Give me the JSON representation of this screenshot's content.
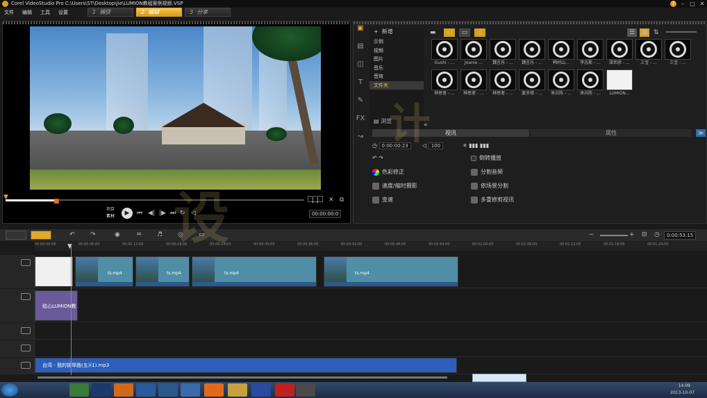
{
  "window": {
    "title": "Corel VideoStudio Pro    C:\\Users\\ST\\Desktop\\jie\\LUMION教程案例视频.VSP"
  },
  "menu": {
    "items": [
      "文件",
      "编辑",
      "工具",
      "设置"
    ]
  },
  "steps": [
    {
      "num": "1",
      "label": "捕获"
    },
    {
      "num": "2",
      "label": "编辑"
    },
    {
      "num": "3",
      "label": "分享"
    }
  ],
  "player": {
    "mode_top": "项目",
    "mode_bottom": "素材",
    "timecode": "00:00:00:0",
    "scrub_progress": 0.17
  },
  "library": {
    "add_label": "新增",
    "folders": [
      "示例",
      "视频",
      "图片",
      "音乐",
      "音效",
      "文件夹"
    ],
    "selected_folder": "文件夹",
    "browse_label": "浏览",
    "thumbs": [
      "Gushi - ...",
      "Joanie ...",
      "魏言乐 - ...",
      "魏言乐 - ...",
      "韩村山...",
      "李志斯 - ...",
      "梁邦彦 - ...",
      "三宝 - ...",
      "三宝 - ...",
      "神思者 - ...",
      "神思者 - ...",
      "神思者 - ...",
      "姜多修 - ...",
      "来兵陈 - ...",
      "来兵陈 - ...",
      "LUMION..."
    ]
  },
  "options": {
    "tab_video": "视讯",
    "tab_attr": "属性",
    "duration": "0:00:00:23",
    "volume": "100",
    "reverse": "倒转播放",
    "color": "色彩修正",
    "speed": "速度/缩时摄影",
    "transform": "变速",
    "split_audio": "分割音频",
    "scene_split": "依场景分割",
    "multi_trim": "多重修剪视讯"
  },
  "timeline": {
    "total": "0:00:53:15",
    "ruler": [
      "00:00:00:00",
      "00:00:06:00",
      "00:00:12:00",
      "00:00:18:00",
      "00:00:24:00",
      "00:00:30:00",
      "00:00:36:00",
      "00:00:42:00",
      "00:00:48:00",
      "00:00:54:00",
      "00:01:00:00",
      "00:01:06:00",
      "00:01:12:00",
      "00:01:18:00",
      "00:01:24:00"
    ],
    "video_clips": [
      "ts.mp4",
      "ts.mp4",
      "ts.mp4",
      "ts.mp4"
    ],
    "overlay_clip": "绘心LUMION教",
    "music_clip": "台湾 - 我的钢琴曲(五)(1).mp3"
  },
  "taskbar": {
    "time": "14:09",
    "date": "2013-10-07"
  }
}
